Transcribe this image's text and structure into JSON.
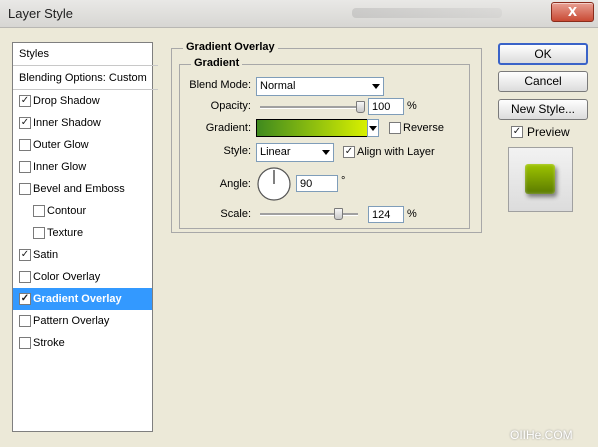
{
  "window": {
    "title": "Layer Style",
    "close_glyph": "X"
  },
  "styles_list": {
    "header": "Styles",
    "blending": "Blending Options: Custom",
    "items": [
      {
        "label": "Drop Shadow",
        "checked": true
      },
      {
        "label": "Inner Shadow",
        "checked": true
      },
      {
        "label": "Outer Glow",
        "checked": false
      },
      {
        "label": "Inner Glow",
        "checked": false
      },
      {
        "label": "Bevel and Emboss",
        "checked": false
      },
      {
        "label": "Contour",
        "checked": false
      },
      {
        "label": "Texture",
        "checked": false
      },
      {
        "label": "Satin",
        "checked": true
      },
      {
        "label": "Color Overlay",
        "checked": false
      },
      {
        "label": "Gradient Overlay",
        "checked": true
      },
      {
        "label": "Pattern Overlay",
        "checked": false
      },
      {
        "label": "Stroke",
        "checked": false
      }
    ]
  },
  "panel": {
    "title": "Gradient Overlay",
    "subtitle": "Gradient",
    "blend_mode_label": "Blend Mode:",
    "blend_mode_value": "Normal",
    "opacity_label": "Opacity:",
    "opacity_value": "100",
    "opacity_unit": "%",
    "opacity_fraction": 1.0,
    "gradient_label": "Gradient:",
    "gradient_colors": [
      "#3f8a1e",
      "#d8f000"
    ],
    "reverse_label": "Reverse",
    "style_label": "Style:",
    "style_value": "Linear",
    "align_label": "Align with Layer",
    "angle_label": "Angle:",
    "angle_value": "90",
    "angle_unit": "°",
    "scale_label": "Scale:",
    "scale_value": "124",
    "scale_unit": "%",
    "scale_fraction": 0.8
  },
  "buttons": {
    "ok": "OK",
    "cancel": "Cancel",
    "new_style": "New Style...",
    "preview_label": "Preview",
    "preview_checked": true
  },
  "preview_colors": [
    "#9ec400",
    "#5a7a00"
  ],
  "watermark": "OIIHe.COM"
}
